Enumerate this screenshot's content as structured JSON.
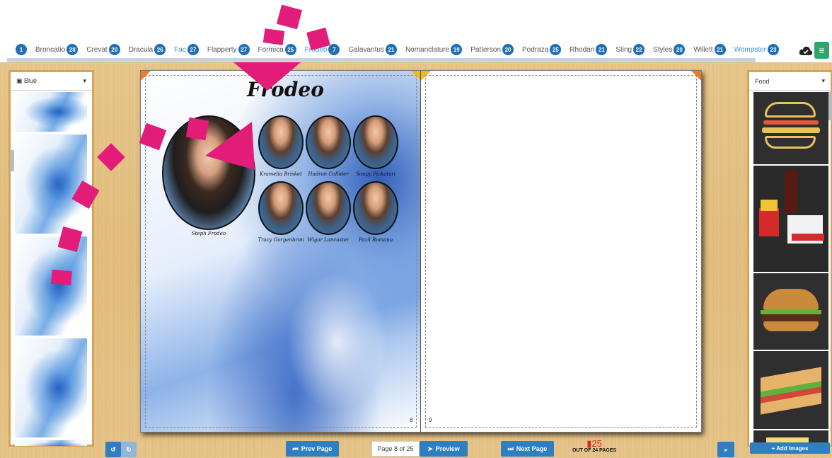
{
  "tabs": [
    {
      "name": "",
      "count": "1"
    },
    {
      "name": "Broncatio",
      "count": "28"
    },
    {
      "name": "Crevat",
      "count": "20"
    },
    {
      "name": "Dracula",
      "count": "26"
    },
    {
      "name": "Fac",
      "count": "27"
    },
    {
      "name": "Flapperty",
      "count": "27"
    },
    {
      "name": "Formica",
      "count": "25"
    },
    {
      "name": "Frodeo",
      "count": "7"
    },
    {
      "name": "Galavantus",
      "count": "21"
    },
    {
      "name": "Nomanclature",
      "count": "19"
    },
    {
      "name": "Patterson",
      "count": "20"
    },
    {
      "name": "Podraza",
      "count": "25"
    },
    {
      "name": "Rhodan",
      "count": "21"
    },
    {
      "name": "Sting",
      "count": "22"
    },
    {
      "name": "Styles",
      "count": "20"
    },
    {
      "name": "Willett",
      "count": "21"
    },
    {
      "name": "Wompster",
      "count": "23"
    }
  ],
  "left_panel": {
    "select_value": "Blue"
  },
  "right_panel": {
    "select_value": "Food",
    "add_images_label": "+ Add Images"
  },
  "book": {
    "title": "Frodeo",
    "teacher": {
      "name": "Steph Frodeo"
    },
    "students": [
      {
        "name": "Kramelia Brisket"
      },
      {
        "name": "Hadron Collider"
      },
      {
        "name": "Soupy Pickatori"
      },
      {
        "name": "Tracy Gorgenbron"
      },
      {
        "name": "Wigar Lancaster"
      },
      {
        "name": "Pazil Romano"
      }
    ],
    "left_page_number": "8",
    "right_page_number": "9"
  },
  "controls": {
    "prev_label": "Prev Page",
    "page_indicator": "Page 8 of 25",
    "preview_label": "Preview",
    "next_label": "Next Page",
    "pages_total": "25",
    "pages_out_of": "OUT OF 24 PAGES"
  },
  "colors": {
    "accent": "#2f7fc0",
    "badge": "#1f6fb5",
    "marker": "#e31c79",
    "green": "#27a96b"
  }
}
